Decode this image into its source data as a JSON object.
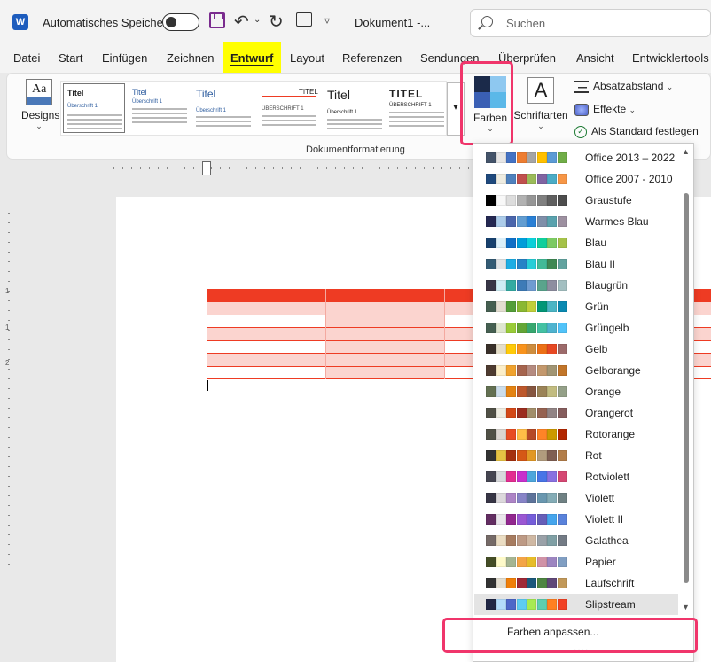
{
  "titlebar": {
    "app_icon": "word-icon",
    "app_icon_letter": "W",
    "autosave_label": "Automatisches Speichern",
    "document_title": "Dokument1  -...",
    "search_placeholder": "Suchen"
  },
  "tabs": [
    {
      "label": "Datei"
    },
    {
      "label": "Start"
    },
    {
      "label": "Einfügen"
    },
    {
      "label": "Zeichnen"
    },
    {
      "label": "Entwurf",
      "active": true
    },
    {
      "label": "Layout"
    },
    {
      "label": "Referenzen"
    },
    {
      "label": "Sendungen"
    },
    {
      "label": "Überprüfen"
    },
    {
      "label": "Ansicht"
    },
    {
      "label": "Entwicklertools"
    }
  ],
  "ribbon": {
    "designs_label": "Designs",
    "style_sets": [
      {
        "title": "Titel",
        "heading": "Überschrift 1"
      },
      {
        "title": "Titel",
        "heading": "Überschrift 1"
      },
      {
        "title": "Titel",
        "heading": "Überschrift 1"
      },
      {
        "title": "TITEL",
        "heading": "ÜBERSCHRIFT 1"
      },
      {
        "title": "Titel",
        "heading": "Überschrift 1"
      },
      {
        "title": "TITEL",
        "heading": "ÜBERSCHRIFT 1"
      }
    ],
    "group_label": "Dokumentformatierung",
    "farben_label": "Farben",
    "schriftarten_label": "Schriftarten",
    "schriftarten_glyph": "A",
    "absatzabstand_label": "Absatzabstand",
    "effekte_label": "Effekte",
    "standard_label": "Als Standard festlegen"
  },
  "colors": {
    "highlight_yellow": "#ffff00",
    "callout_pink": "#f0356b",
    "table_red": "#ee3b23",
    "table_light": "#fbd4cf"
  },
  "color_schemes": [
    {
      "name": "Office 2013 – 2022",
      "colors": [
        "#44546a",
        "#e7e6e6",
        "#4472c4",
        "#ed7d31",
        "#a5a5a5",
        "#ffc000",
        "#5b9bd5",
        "#70ad47"
      ]
    },
    {
      "name": "Office 2007 - 2010",
      "colors": [
        "#1f497d",
        "#eeece1",
        "#4f81bd",
        "#c0504d",
        "#9bbb59",
        "#8064a2",
        "#4bacc6",
        "#f79646"
      ]
    },
    {
      "name": "Graustufe",
      "colors": [
        "#000000",
        "#f8f8f8",
        "#dddddd",
        "#b2b2b2",
        "#969696",
        "#808080",
        "#5f5f5f",
        "#4d4d4d"
      ]
    },
    {
      "name": "Warmes Blau",
      "colors": [
        "#242852",
        "#acccea",
        "#4a66ac",
        "#629dd1",
        "#297fd5",
        "#7f8fa9",
        "#5aa2ae",
        "#9d90a0"
      ]
    },
    {
      "name": "Blau",
      "colors": [
        "#17406d",
        "#dbeff9",
        "#0f6fc6",
        "#009dd9",
        "#0bd0d9",
        "#10cf9b",
        "#7cca62",
        "#a5c249"
      ]
    },
    {
      "name": "Blau II",
      "colors": [
        "#335b74",
        "#dfe3e5",
        "#1cade4",
        "#2683c6",
        "#27ced7",
        "#42ba97",
        "#3e8853",
        "#62a39f"
      ]
    },
    {
      "name": "Blaugrün",
      "colors": [
        "#373545",
        "#ceedf4",
        "#34aba2",
        "#3d7bb7",
        "#6f9cd1",
        "#5aa48c",
        "#8e8ea0",
        "#a3bfc1"
      ]
    },
    {
      "name": "Grün",
      "colors": [
        "#455f51",
        "#e3ded1",
        "#549e39",
        "#8ab833",
        "#c0cf3a",
        "#029676",
        "#4ab5c4",
        "#0989b1"
      ]
    },
    {
      "name": "Grüngelb",
      "colors": [
        "#455f51",
        "#dfe6d0",
        "#99cb38",
        "#63a537",
        "#37a76f",
        "#44c1a3",
        "#4eb3cf",
        "#51c3f9"
      ]
    },
    {
      "name": "Gelb",
      "colors": [
        "#39302a",
        "#e5dec9",
        "#ffca08",
        "#f8931d",
        "#ce8d3e",
        "#ec7016",
        "#e64823",
        "#9c6a6a"
      ]
    },
    {
      "name": "Gelborange",
      "colors": [
        "#4e3b30",
        "#fbeec9",
        "#f0a22e",
        "#a5644e",
        "#b58b80",
        "#c3986d",
        "#a19574",
        "#c17529"
      ]
    },
    {
      "name": "Orange",
      "colors": [
        "#637052",
        "#ccddea",
        "#e48312",
        "#bd582c",
        "#865640",
        "#9b8357",
        "#c2bc80",
        "#94a088"
      ]
    },
    {
      "name": "Orangerot",
      "colors": [
        "#505046",
        "#eeece1",
        "#d34817",
        "#9b2d1f",
        "#a28e6a",
        "#956251",
        "#918485",
        "#855d5d"
      ]
    },
    {
      "name": "Rotorange",
      "colors": [
        "#505046",
        "#dbd5d0",
        "#e84c22",
        "#ffbd47",
        "#b64926",
        "#ff8427",
        "#cc9900",
        "#b22600"
      ]
    },
    {
      "name": "Rot",
      "colors": [
        "#323232",
        "#e5c243",
        "#a5300f",
        "#d55816",
        "#e19825",
        "#b19c7d",
        "#7f5f52",
        "#b27d49"
      ]
    },
    {
      "name": "Rotviolett",
      "colors": [
        "#454551",
        "#d8d9dc",
        "#e32d91",
        "#c830cc",
        "#4ea6dc",
        "#4775e7",
        "#8971e1",
        "#d54773"
      ]
    },
    {
      "name": "Violett",
      "colors": [
        "#373545",
        "#dcd8dc",
        "#ad84c6",
        "#8784c7",
        "#5d739a",
        "#6997af",
        "#84acb6",
        "#6f8183"
      ]
    },
    {
      "name": "Violett II",
      "colors": [
        "#632e62",
        "#eae5eb",
        "#92278f",
        "#9b57d3",
        "#755dd9",
        "#665eb8",
        "#45a5ed",
        "#5982db"
      ]
    },
    {
      "name": "Galathea",
      "colors": [
        "#756a67",
        "#ebddc3",
        "#a77c60",
        "#bd9a85",
        "#cfb8a3",
        "#9aa1a8",
        "#80a0a5",
        "#737b85"
      ]
    },
    {
      "name": "Papier",
      "colors": [
        "#444d26",
        "#fefac9",
        "#a5b592",
        "#f3a447",
        "#e7bc29",
        "#d092a7",
        "#9c85c0",
        "#809ec2"
      ]
    },
    {
      "name": "Laufschrift",
      "colors": [
        "#323232",
        "#e3ded1",
        "#f07f09",
        "#9f2936",
        "#1b587c",
        "#4e8542",
        "#604878",
        "#c19859"
      ]
    },
    {
      "name": "Slipstream",
      "colors": [
        "#212745",
        "#b4dcfa",
        "#4e67c8",
        "#5eccf3",
        "#a7ea52",
        "#5dceaf",
        "#ff8021",
        "#f14124"
      ],
      "selected": true
    }
  ],
  "dropdown_footer": {
    "customize_label": "Farben anpassen..."
  },
  "ruler": {
    "vertical_numbers": [
      "1",
      "1",
      "2"
    ]
  }
}
